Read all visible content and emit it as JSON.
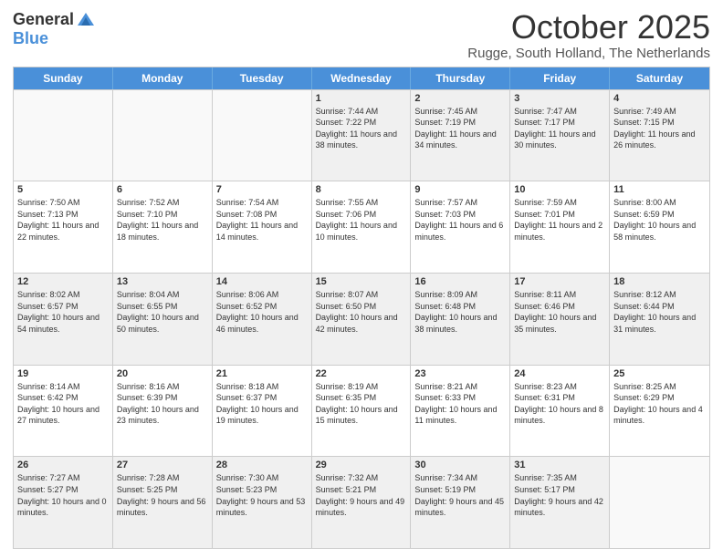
{
  "logo": {
    "general": "General",
    "blue": "Blue"
  },
  "title": "October 2025",
  "location": "Rugge, South Holland, The Netherlands",
  "days_of_week": [
    "Sunday",
    "Monday",
    "Tuesday",
    "Wednesday",
    "Thursday",
    "Friday",
    "Saturday"
  ],
  "weeks": [
    [
      {
        "day": "",
        "sunrise": "",
        "sunset": "",
        "daylight": "",
        "empty": true
      },
      {
        "day": "",
        "sunrise": "",
        "sunset": "",
        "daylight": "",
        "empty": true
      },
      {
        "day": "",
        "sunrise": "",
        "sunset": "",
        "daylight": "",
        "empty": true
      },
      {
        "day": "1",
        "sunrise": "Sunrise: 7:44 AM",
        "sunset": "Sunset: 7:22 PM",
        "daylight": "Daylight: 11 hours and 38 minutes."
      },
      {
        "day": "2",
        "sunrise": "Sunrise: 7:45 AM",
        "sunset": "Sunset: 7:19 PM",
        "daylight": "Daylight: 11 hours and 34 minutes."
      },
      {
        "day": "3",
        "sunrise": "Sunrise: 7:47 AM",
        "sunset": "Sunset: 7:17 PM",
        "daylight": "Daylight: 11 hours and 30 minutes."
      },
      {
        "day": "4",
        "sunrise": "Sunrise: 7:49 AM",
        "sunset": "Sunset: 7:15 PM",
        "daylight": "Daylight: 11 hours and 26 minutes."
      }
    ],
    [
      {
        "day": "5",
        "sunrise": "Sunrise: 7:50 AM",
        "sunset": "Sunset: 7:13 PM",
        "daylight": "Daylight: 11 hours and 22 minutes."
      },
      {
        "day": "6",
        "sunrise": "Sunrise: 7:52 AM",
        "sunset": "Sunset: 7:10 PM",
        "daylight": "Daylight: 11 hours and 18 minutes."
      },
      {
        "day": "7",
        "sunrise": "Sunrise: 7:54 AM",
        "sunset": "Sunset: 7:08 PM",
        "daylight": "Daylight: 11 hours and 14 minutes."
      },
      {
        "day": "8",
        "sunrise": "Sunrise: 7:55 AM",
        "sunset": "Sunset: 7:06 PM",
        "daylight": "Daylight: 11 hours and 10 minutes."
      },
      {
        "day": "9",
        "sunrise": "Sunrise: 7:57 AM",
        "sunset": "Sunset: 7:03 PM",
        "daylight": "Daylight: 11 hours and 6 minutes."
      },
      {
        "day": "10",
        "sunrise": "Sunrise: 7:59 AM",
        "sunset": "Sunset: 7:01 PM",
        "daylight": "Daylight: 11 hours and 2 minutes."
      },
      {
        "day": "11",
        "sunrise": "Sunrise: 8:00 AM",
        "sunset": "Sunset: 6:59 PM",
        "daylight": "Daylight: 10 hours and 58 minutes."
      }
    ],
    [
      {
        "day": "12",
        "sunrise": "Sunrise: 8:02 AM",
        "sunset": "Sunset: 6:57 PM",
        "daylight": "Daylight: 10 hours and 54 minutes."
      },
      {
        "day": "13",
        "sunrise": "Sunrise: 8:04 AM",
        "sunset": "Sunset: 6:55 PM",
        "daylight": "Daylight: 10 hours and 50 minutes."
      },
      {
        "day": "14",
        "sunrise": "Sunrise: 8:06 AM",
        "sunset": "Sunset: 6:52 PM",
        "daylight": "Daylight: 10 hours and 46 minutes."
      },
      {
        "day": "15",
        "sunrise": "Sunrise: 8:07 AM",
        "sunset": "Sunset: 6:50 PM",
        "daylight": "Daylight: 10 hours and 42 minutes."
      },
      {
        "day": "16",
        "sunrise": "Sunrise: 8:09 AM",
        "sunset": "Sunset: 6:48 PM",
        "daylight": "Daylight: 10 hours and 38 minutes."
      },
      {
        "day": "17",
        "sunrise": "Sunrise: 8:11 AM",
        "sunset": "Sunset: 6:46 PM",
        "daylight": "Daylight: 10 hours and 35 minutes."
      },
      {
        "day": "18",
        "sunrise": "Sunrise: 8:12 AM",
        "sunset": "Sunset: 6:44 PM",
        "daylight": "Daylight: 10 hours and 31 minutes."
      }
    ],
    [
      {
        "day": "19",
        "sunrise": "Sunrise: 8:14 AM",
        "sunset": "Sunset: 6:42 PM",
        "daylight": "Daylight: 10 hours and 27 minutes."
      },
      {
        "day": "20",
        "sunrise": "Sunrise: 8:16 AM",
        "sunset": "Sunset: 6:39 PM",
        "daylight": "Daylight: 10 hours and 23 minutes."
      },
      {
        "day": "21",
        "sunrise": "Sunrise: 8:18 AM",
        "sunset": "Sunset: 6:37 PM",
        "daylight": "Daylight: 10 hours and 19 minutes."
      },
      {
        "day": "22",
        "sunrise": "Sunrise: 8:19 AM",
        "sunset": "Sunset: 6:35 PM",
        "daylight": "Daylight: 10 hours and 15 minutes."
      },
      {
        "day": "23",
        "sunrise": "Sunrise: 8:21 AM",
        "sunset": "Sunset: 6:33 PM",
        "daylight": "Daylight: 10 hours and 11 minutes."
      },
      {
        "day": "24",
        "sunrise": "Sunrise: 8:23 AM",
        "sunset": "Sunset: 6:31 PM",
        "daylight": "Daylight: 10 hours and 8 minutes."
      },
      {
        "day": "25",
        "sunrise": "Sunrise: 8:25 AM",
        "sunset": "Sunset: 6:29 PM",
        "daylight": "Daylight: 10 hours and 4 minutes."
      }
    ],
    [
      {
        "day": "26",
        "sunrise": "Sunrise: 7:27 AM",
        "sunset": "Sunset: 5:27 PM",
        "daylight": "Daylight: 10 hours and 0 minutes."
      },
      {
        "day": "27",
        "sunrise": "Sunrise: 7:28 AM",
        "sunset": "Sunset: 5:25 PM",
        "daylight": "Daylight: 9 hours and 56 minutes."
      },
      {
        "day": "28",
        "sunrise": "Sunrise: 7:30 AM",
        "sunset": "Sunset: 5:23 PM",
        "daylight": "Daylight: 9 hours and 53 minutes."
      },
      {
        "day": "29",
        "sunrise": "Sunrise: 7:32 AM",
        "sunset": "Sunset: 5:21 PM",
        "daylight": "Daylight: 9 hours and 49 minutes."
      },
      {
        "day": "30",
        "sunrise": "Sunrise: 7:34 AM",
        "sunset": "Sunset: 5:19 PM",
        "daylight": "Daylight: 9 hours and 45 minutes."
      },
      {
        "day": "31",
        "sunrise": "Sunrise: 7:35 AM",
        "sunset": "Sunset: 5:17 PM",
        "daylight": "Daylight: 9 hours and 42 minutes."
      },
      {
        "day": "",
        "sunrise": "",
        "sunset": "",
        "daylight": "",
        "empty": true
      }
    ]
  ]
}
